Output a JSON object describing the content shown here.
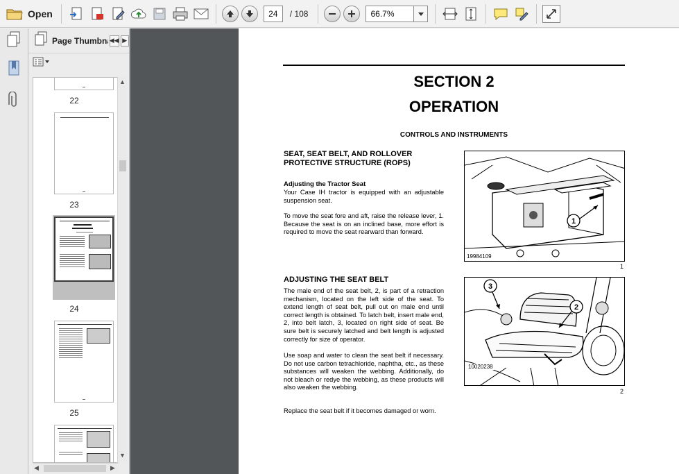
{
  "toolbar": {
    "open_label": "Open",
    "current_page": "24",
    "total_pages": "/ 108",
    "zoom": "66.7%"
  },
  "sidebar": {
    "panel_title": "Page Thumbna..."
  },
  "thumbnails": [
    {
      "page_label": "22"
    },
    {
      "page_label": "23"
    },
    {
      "page_label": "24",
      "selected": true
    },
    {
      "page_label": "25"
    }
  ],
  "document": {
    "section_line1": "SECTION 2",
    "section_line2": "OPERATION",
    "controls_heading": "CONTROLS AND INSTRUMENTS",
    "seat_heading_line1": "SEAT, SEAT BELT, AND ROLLOVER",
    "seat_heading_line2": "PROTECTIVE STRUCTURE (ROPS)",
    "adjusting_seat_heading": "Adjusting the Tractor Seat",
    "adjusting_seat_p1": "Your Case IH tractor is equipped with an adjustable suspension seat.",
    "adjusting_seat_p2": "To move the seat fore and aft, raise the release lever, 1. Because the seat is on an inclined base, more effort is required to move the seat rearward than forward.",
    "seatbelt_heading": "ADJUSTING THE SEAT BELT",
    "seatbelt_p1": "The male end of the seat belt, 2, is part of a retraction mechanism, located on the left side of the seat. To extend length of seat belt, pull out on male end until correct length is obtained. To latch belt, insert male end, 2, into belt latch, 3, located on right side of seat. Be sure belt is securely latched and belt length is adjusted correctly for size of operator.",
    "seatbelt_p2": "Use soap and water to clean the seat belt if necessary. Do not use carbon tetrachloride, naphtha, etc., as these substances will weaken the webbing. Additionally, do not bleach or redye the webbing, as these products will also weaken the webbing.",
    "seatbelt_p3": "Replace the seat belt if it becomes damaged or worn.",
    "figure1": {
      "code": "19984109",
      "number": "1",
      "callout": "1"
    },
    "figure2": {
      "code": "10020238",
      "number": "2",
      "callout_a": "3",
      "callout_b": "2"
    }
  }
}
